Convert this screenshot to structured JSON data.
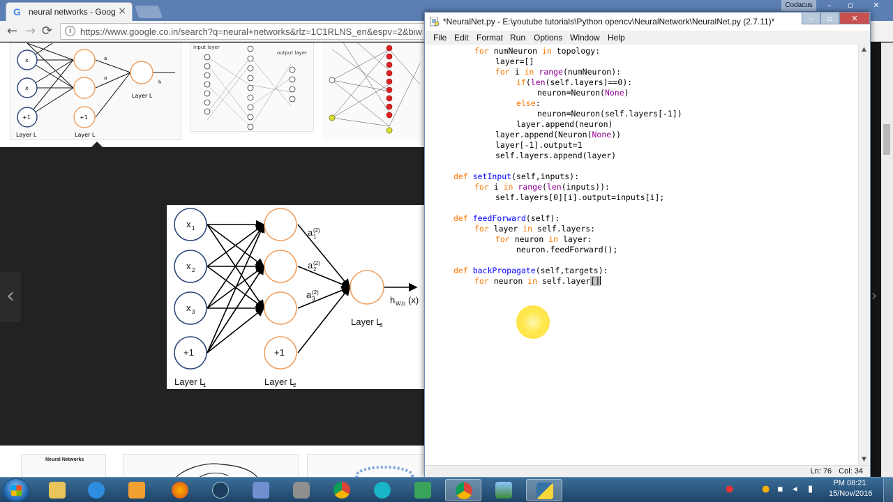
{
  "browser": {
    "tab_title": "neural networks - Googl",
    "tab_close": "×",
    "google_letter": "G",
    "url": "https://www.google.co.in/search?q=neural+networks&rlz=1C1RLNS_en&espv=2&biw",
    "info_glyph": "i",
    "back_glyph": "←",
    "forward_glyph": "→",
    "reload_glyph": "⟳",
    "prev_glyph": "‹",
    "next_glyph": "›",
    "bottom_thumb_title": "Neural Networks",
    "window_user": "Codacus",
    "window_min": "–",
    "window_max": "▫",
    "window_close": "✕"
  },
  "thumbs": {
    "t1": {
      "layer_l1": "Layer L",
      "layer_l2": "Layer L",
      "layer_l3": "Layer L",
      "x2": "x",
      "x3": "x",
      "plus1": "+1",
      "plus1b": "+1",
      "hwb": "h",
      "a2": "a",
      "a3": "a"
    },
    "t2": {
      "input_layer": "input layer",
      "output_layer": "output layer"
    }
  },
  "figure": {
    "x1": "x",
    "x2": "x",
    "x3": "x",
    "sub1": "1",
    "sub2": "2",
    "sub3": "3",
    "bias1": "+1",
    "bias2": "+1",
    "a1": "a",
    "a2": "a",
    "a3": "a",
    "sup2": "(2)",
    "hwb": "h",
    "hwb_sub": "W,b",
    "hwb_arg": "(x)",
    "layer1": "Layer L",
    "layer2": "Layer L",
    "layer3": "Layer L",
    "l1": "1",
    "l2": "2",
    "l3": "3"
  },
  "idle": {
    "title": "*NeuralNet.py - E:\\youtube tutorials\\Python opencv\\NeuralNetwork\\NeuralNet.py (2.7.11)*",
    "menu": [
      "File",
      "Edit",
      "Format",
      "Run",
      "Options",
      "Window",
      "Help"
    ],
    "status_line": "Ln: 76",
    "status_col": "Col: 34",
    "controls": {
      "min": "–",
      "max": "▫",
      "close": "✕"
    },
    "scroll_up": "▲",
    "scroll_down": "▼"
  },
  "code": {
    "l1_kw": "for",
    "l1_a": " numNeuron ",
    "l1_kw2": "in",
    "l1_b": " topology:",
    "l2": "layer=[]",
    "l3_kw": "for",
    "l3_a": " i ",
    "l3_kw2": "in",
    "l3_bi": " range",
    "l3_b": "(numNeuron):",
    "l4_kw": "if",
    "l4_a": "(",
    "l4_bi": "len",
    "l4_b": "(self.layers)==0):",
    "l5_a": "neuron=Neuron(",
    "l5_bi": "None",
    "l5_b": ")",
    "l6_kw": "else",
    "l6_b": ":",
    "l7": "neuron=Neuron(self.layers[-1])",
    "l8": "layer.append(neuron)",
    "l9_a": "layer.append(Neuron(",
    "l9_bi": "None",
    "l9_b": "))",
    "l10": "layer[-1].output=1",
    "l11": "self.layers.append(layer)",
    "l12_kw": "def",
    "l12_df": " setInput",
    "l12_b": "(self,inputs):",
    "l13_kw": "for",
    "l13_a": " i ",
    "l13_kw2": "in",
    "l13_bi": " range",
    "l13_b": "(",
    "l13_bi2": "len",
    "l13_c": "(inputs)):",
    "l14": "self.layers[0][i].output=inputs[i];",
    "l15_kw": "def",
    "l15_df": " feedForward",
    "l15_b": "(self):",
    "l16_kw": "for",
    "l16_a": " layer ",
    "l16_kw2": "in",
    "l16_b": " self.layers:",
    "l17_kw": "for",
    "l17_a": " neuron ",
    "l17_kw2": "in",
    "l17_b": " layer:",
    "l18": "neuron.feedForward();",
    "l19_kw": "def",
    "l19_df": " backPropagate",
    "l19_b": "(self,targets):",
    "l20_kw": "for",
    "l20_a": " neuron ",
    "l20_kw2": "in",
    "l20_b": " self.layer",
    "l20_c": "[]"
  },
  "taskbar": {
    "clock_time": "PM 08:21",
    "clock_date": "15/Nov/2016",
    "items": [
      "start",
      "explorer",
      "internet-explorer",
      "media-player",
      "firefox",
      "app",
      "ms-office",
      "database",
      "chrome",
      "headphones",
      "calendar",
      "chrome-active",
      "image-viewer",
      "python-idle"
    ]
  },
  "colors": {
    "keyword": "#ff7700",
    "builtin": "#900090",
    "definition": "#0000ff",
    "neuron_input": "#2e4a7a",
    "neuron_hidden": "#f0a060"
  }
}
